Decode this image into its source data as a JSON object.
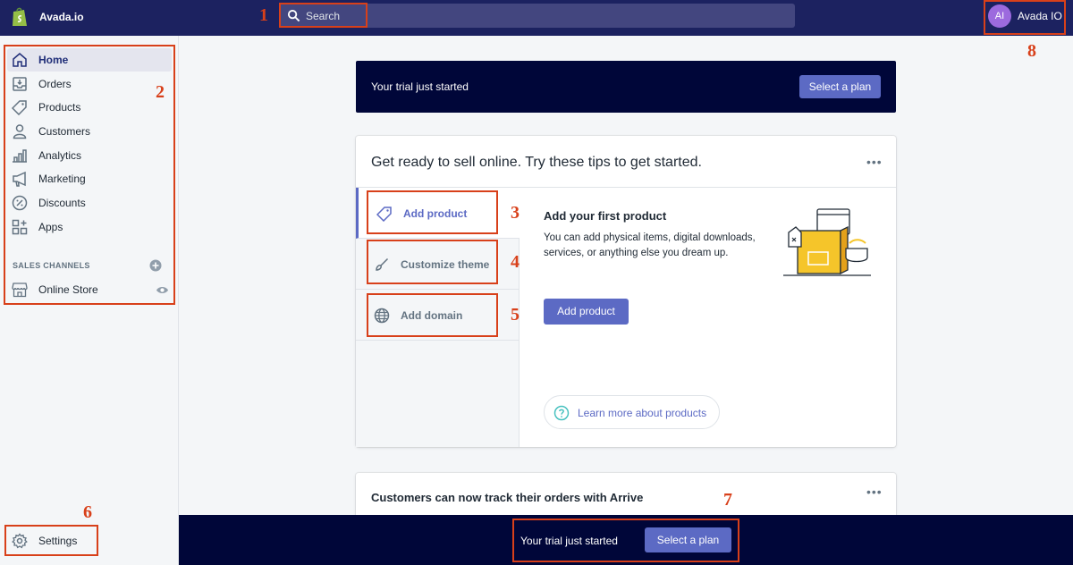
{
  "topbar": {
    "store_name": "Avada.io",
    "search_placeholder": "Search",
    "avatar_initials": "AI",
    "account_name": "Avada IO"
  },
  "sidebar": {
    "items": [
      {
        "label": "Home",
        "icon": "home-icon",
        "active": true
      },
      {
        "label": "Orders",
        "icon": "orders-icon"
      },
      {
        "label": "Products",
        "icon": "tag-icon"
      },
      {
        "label": "Customers",
        "icon": "person-icon"
      },
      {
        "label": "Analytics",
        "icon": "bar-chart-icon"
      },
      {
        "label": "Marketing",
        "icon": "megaphone-icon"
      },
      {
        "label": "Discounts",
        "icon": "discount-icon"
      },
      {
        "label": "Apps",
        "icon": "apps-icon"
      }
    ],
    "sales_channels_title": "SALES CHANNELS",
    "online_store": "Online Store",
    "settings": "Settings"
  },
  "trial_banner": {
    "text": "Your trial just started",
    "button": "Select a plan"
  },
  "tips_card": {
    "title": "Get ready to sell online. Try these tips to get started.",
    "tabs": [
      {
        "label": "Add product",
        "icon": "tag-icon",
        "active": true
      },
      {
        "label": "Customize theme",
        "icon": "brush-icon"
      },
      {
        "label": "Add domain",
        "icon": "globe-icon"
      }
    ],
    "content_title": "Add your first product",
    "content_desc": "You can add physical items, digital downloads, services, or anything else you dream up.",
    "add_button": "Add product",
    "learn_more": "Learn more about products"
  },
  "arrive_card": {
    "title": "Customers can now track their orders with Arrive"
  },
  "bottom_bar": {
    "text": "Your trial just started",
    "button": "Select a plan"
  },
  "annotations": [
    "1",
    "2",
    "3",
    "4",
    "5",
    "6",
    "7",
    "8"
  ],
  "colors": {
    "topbar": "#1c2260",
    "accent": "#5c6ac4",
    "banner": "#000639",
    "callout": "#d8401a"
  }
}
